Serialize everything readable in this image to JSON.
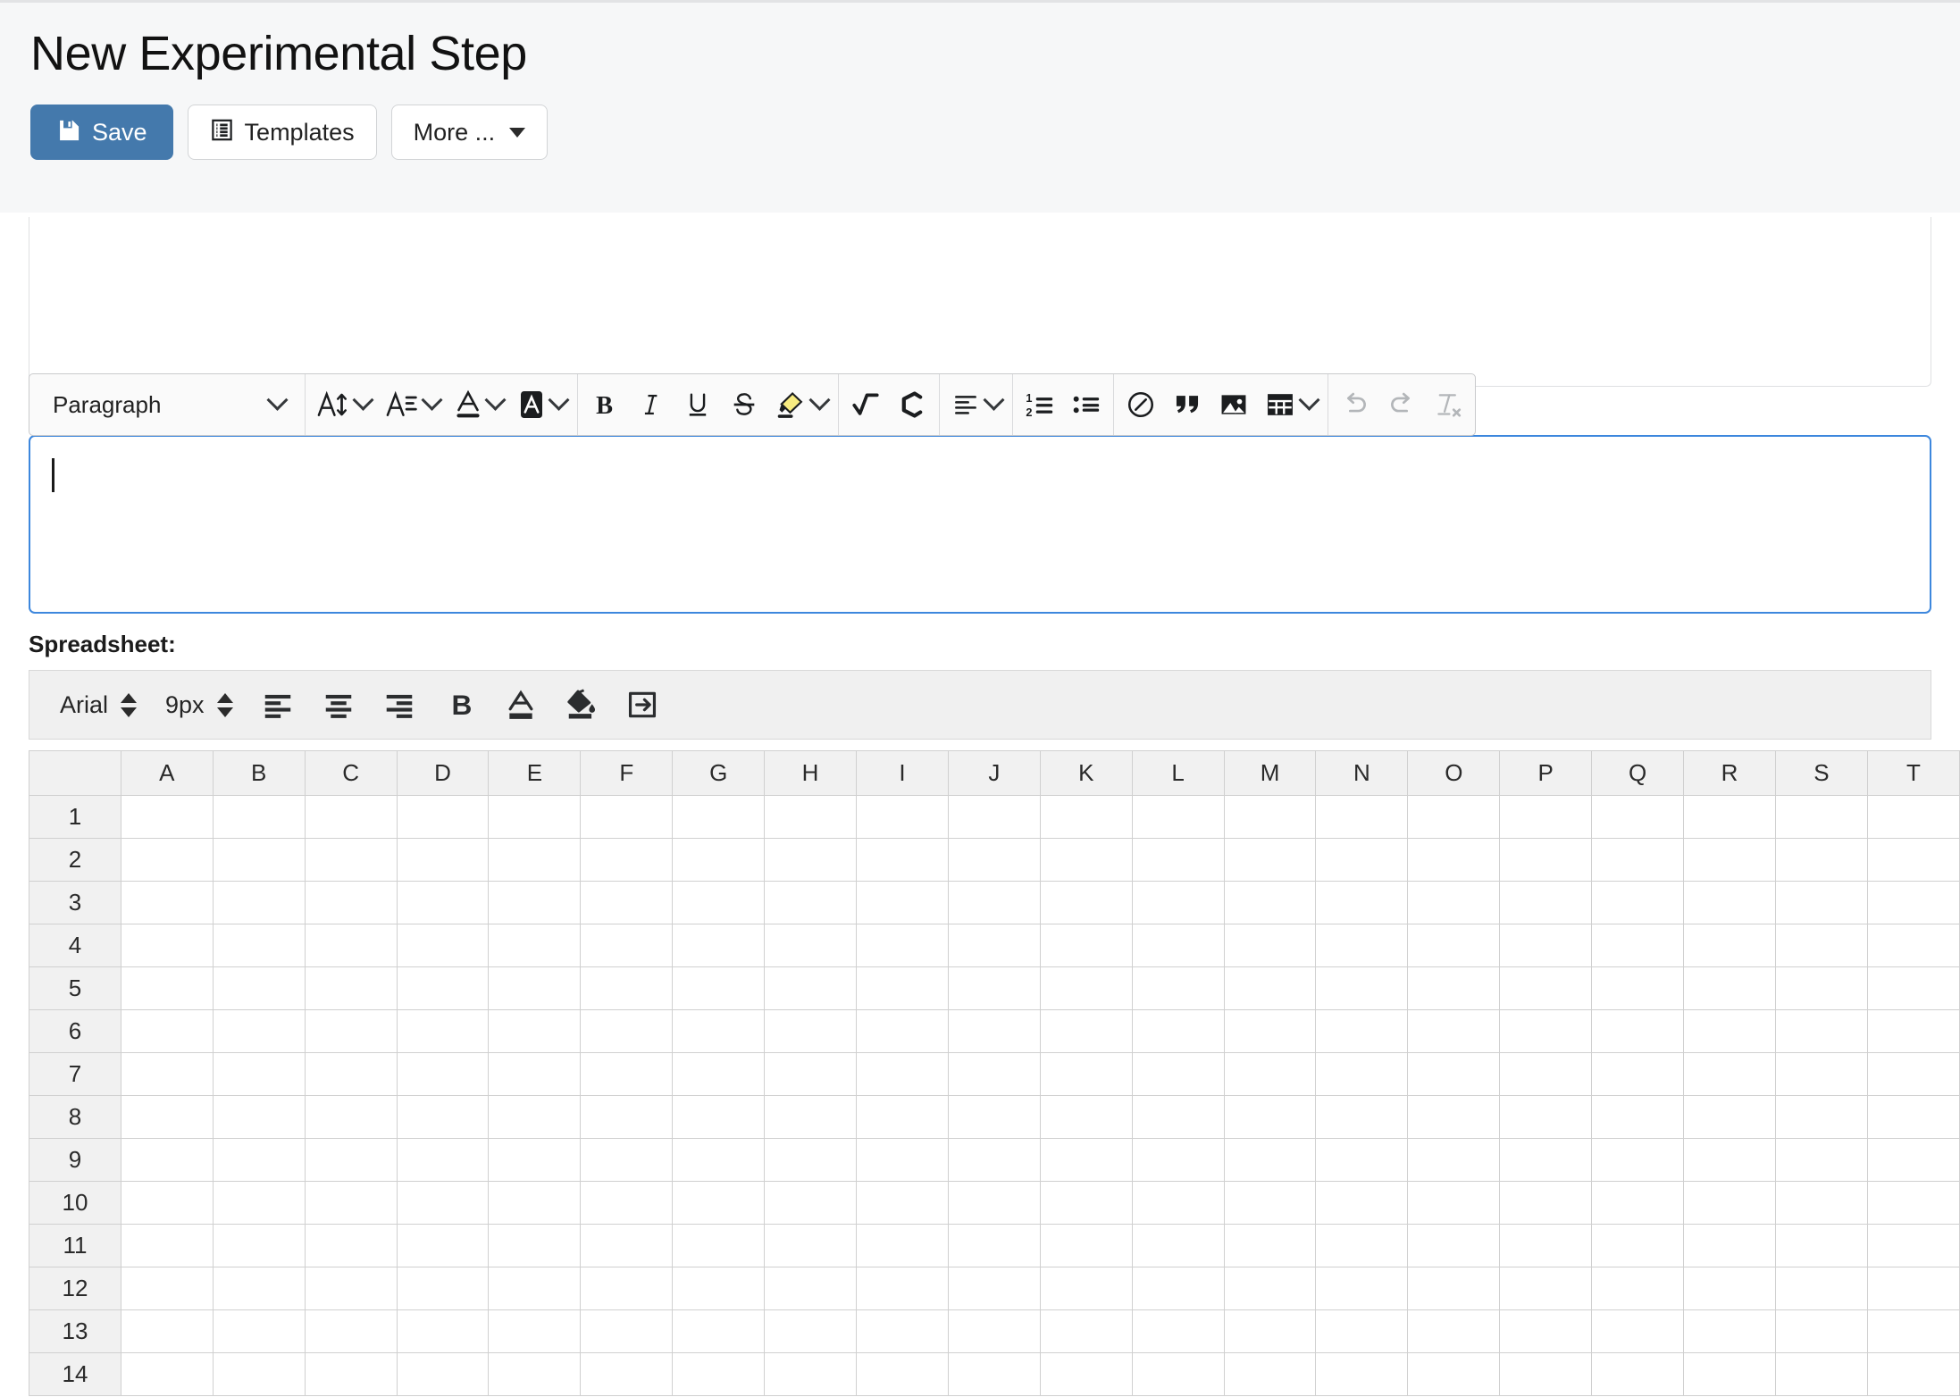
{
  "header": {
    "title": "New Experimental Step",
    "buttons": [
      {
        "label": "Save",
        "icon": "save-floppy-icon",
        "variant": "primary"
      },
      {
        "label": "Templates",
        "icon": "templates-list-icon",
        "variant": "default"
      },
      {
        "label": "More ...",
        "icon": "caret-down-icon",
        "variant": "default"
      }
    ]
  },
  "rich_text_editor": {
    "paragraph_style": "Paragraph",
    "content": "",
    "cursor_visible": true,
    "focus_border_color": "#3d87dd",
    "groups": [
      {
        "name": "styles",
        "items": [
          {
            "icon": "paragraph-style-dropdown",
            "label": "Paragraph",
            "type": "dropdown",
            "disabled": false
          }
        ]
      },
      {
        "name": "font",
        "items": [
          {
            "icon": "font-size-icon",
            "label": "Font Size",
            "type": "dropdown",
            "disabled": false
          },
          {
            "icon": "font-family-icon",
            "label": "Font Family",
            "type": "dropdown",
            "disabled": false
          },
          {
            "icon": "font-color-icon",
            "label": "Font Color",
            "type": "dropdown",
            "disabled": false
          },
          {
            "icon": "background-color-icon",
            "label": "Background Color",
            "type": "dropdown",
            "disabled": false
          }
        ]
      },
      {
        "name": "basic-styles",
        "items": [
          {
            "icon": "bold-icon",
            "label": "Bold",
            "type": "button",
            "disabled": false
          },
          {
            "icon": "italic-icon",
            "label": "Italic",
            "type": "button",
            "disabled": false
          },
          {
            "icon": "underline-icon",
            "label": "Underline",
            "type": "button",
            "disabled": false
          },
          {
            "icon": "strikethrough-icon",
            "label": "Strikethrough",
            "type": "button",
            "disabled": false
          },
          {
            "icon": "highlighter-icon",
            "label": "Highlight",
            "type": "dropdown",
            "disabled": false
          }
        ]
      },
      {
        "name": "science",
        "items": [
          {
            "icon": "math-formula-icon",
            "label": "Math Formula",
            "type": "button",
            "disabled": false
          },
          {
            "icon": "chemistry-icon",
            "label": "Chemistry Formula",
            "type": "button",
            "disabled": false
          }
        ]
      },
      {
        "name": "alignment",
        "items": [
          {
            "icon": "text-align-icon",
            "label": "Text Alignment",
            "type": "dropdown",
            "disabled": false
          }
        ]
      },
      {
        "name": "lists",
        "items": [
          {
            "icon": "numbered-list-icon",
            "label": "Numbered List",
            "type": "button",
            "disabled": false
          },
          {
            "icon": "bulleted-list-icon",
            "label": "Bulleted List",
            "type": "button",
            "disabled": false
          }
        ]
      },
      {
        "name": "insert",
        "items": [
          {
            "icon": "link-icon",
            "label": "Insert Link",
            "type": "button",
            "disabled": false
          },
          {
            "icon": "blockquote-icon",
            "label": "Block Quote",
            "type": "button",
            "disabled": false
          },
          {
            "icon": "image-icon",
            "label": "Insert Image",
            "type": "button",
            "disabled": false
          },
          {
            "icon": "table-icon",
            "label": "Insert Table",
            "type": "dropdown",
            "disabled": false
          }
        ]
      },
      {
        "name": "history",
        "items": [
          {
            "icon": "undo-icon",
            "label": "Undo",
            "type": "button",
            "disabled": true
          },
          {
            "icon": "redo-icon",
            "label": "Redo",
            "type": "button",
            "disabled": true
          },
          {
            "icon": "remove-format-icon",
            "label": "Remove Format",
            "type": "button",
            "disabled": true
          }
        ]
      }
    ]
  },
  "spreadsheet": {
    "label": "Spreadsheet:",
    "font_family": "Arial",
    "font_size": "9px",
    "toolbar_buttons": [
      {
        "icon": "align-left-icon",
        "label": "Align Left"
      },
      {
        "icon": "align-center-icon",
        "label": "Align Center"
      },
      {
        "icon": "align-right-icon",
        "label": "Align Right"
      },
      {
        "icon": "bold-icon",
        "label": "Bold"
      },
      {
        "icon": "text-color-icon",
        "label": "Text Color"
      },
      {
        "icon": "fill-color-icon",
        "label": "Fill Color"
      },
      {
        "icon": "merge-cells-icon",
        "label": "Merge Cells"
      }
    ],
    "columns": [
      "A",
      "B",
      "C",
      "D",
      "E",
      "F",
      "G",
      "H",
      "I",
      "J",
      "K",
      "L",
      "M",
      "N",
      "O",
      "P",
      "Q",
      "R",
      "S",
      "T"
    ],
    "rows": [
      "1",
      "2",
      "3",
      "4",
      "5",
      "6",
      "7",
      "8",
      "9",
      "10",
      "11",
      "12",
      "13",
      "14"
    ],
    "cells": []
  }
}
